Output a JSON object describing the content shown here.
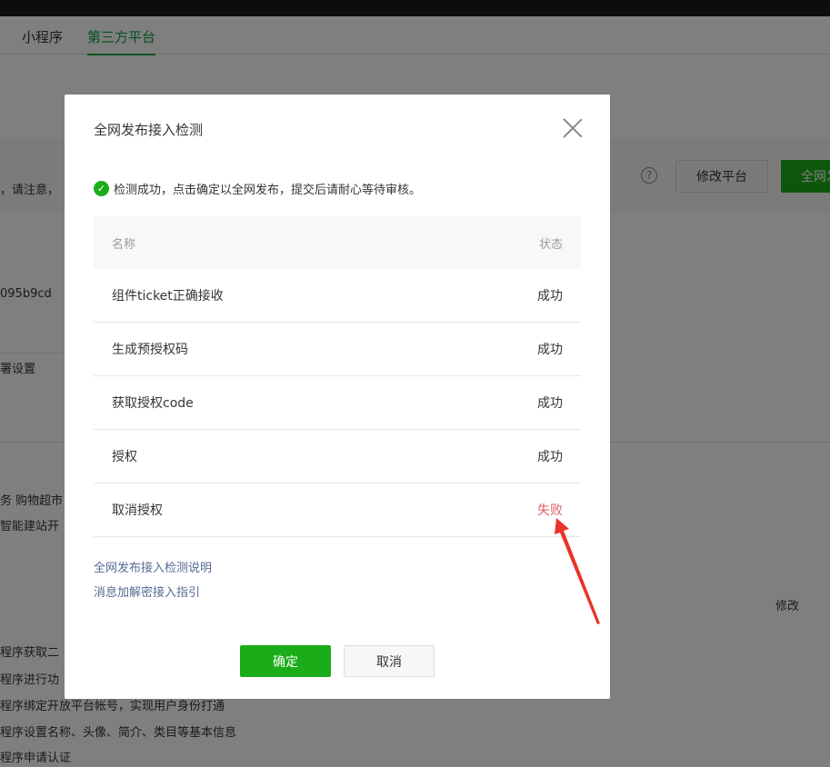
{
  "nav": {
    "tabs": [
      "小程序",
      "第三方平台"
    ],
    "active": "第三方平台"
  },
  "background": {
    "notice_fragment": "，请注意，",
    "id_fragment": "095b9cd",
    "settings_fragment": "署设置",
    "category_fragment": "务 购物超市",
    "site_fragment": "智能建站开",
    "help_label": "?",
    "modify_button": "修改平台",
    "publish_button": "全网发",
    "edit_link": "修改",
    "permissions": [
      "程序获取二",
      "程序进行功",
      "程序绑定开放平台帐号，实现用户身份打通",
      "程序设置名称、头像、简介、类目等基本信息",
      "程序申请认证"
    ]
  },
  "dialog": {
    "title": "全网发布接入检测",
    "success_message": "检测成功，点击确定以全网发布，提交后请耐心等待审核。",
    "table": {
      "header_name": "名称",
      "header_status": "状态",
      "rows": [
        {
          "name": "组件ticket正确接收",
          "status": "成功",
          "failed": false
        },
        {
          "name": "生成预授权码",
          "status": "成功",
          "failed": false
        },
        {
          "name": "获取授权code",
          "status": "成功",
          "failed": false
        },
        {
          "name": "授权",
          "status": "成功",
          "failed": false
        },
        {
          "name": "取消授权",
          "status": "失败",
          "failed": true
        }
      ]
    },
    "links": [
      "全网发布接入检测说明",
      "消息加解密接入指引"
    ],
    "ok_button": "确定",
    "cancel_button": "取消"
  },
  "colors": {
    "accent_green": "#1aad19",
    "failed_red": "#e15f63",
    "annotation_arrow": "#e8342a"
  }
}
